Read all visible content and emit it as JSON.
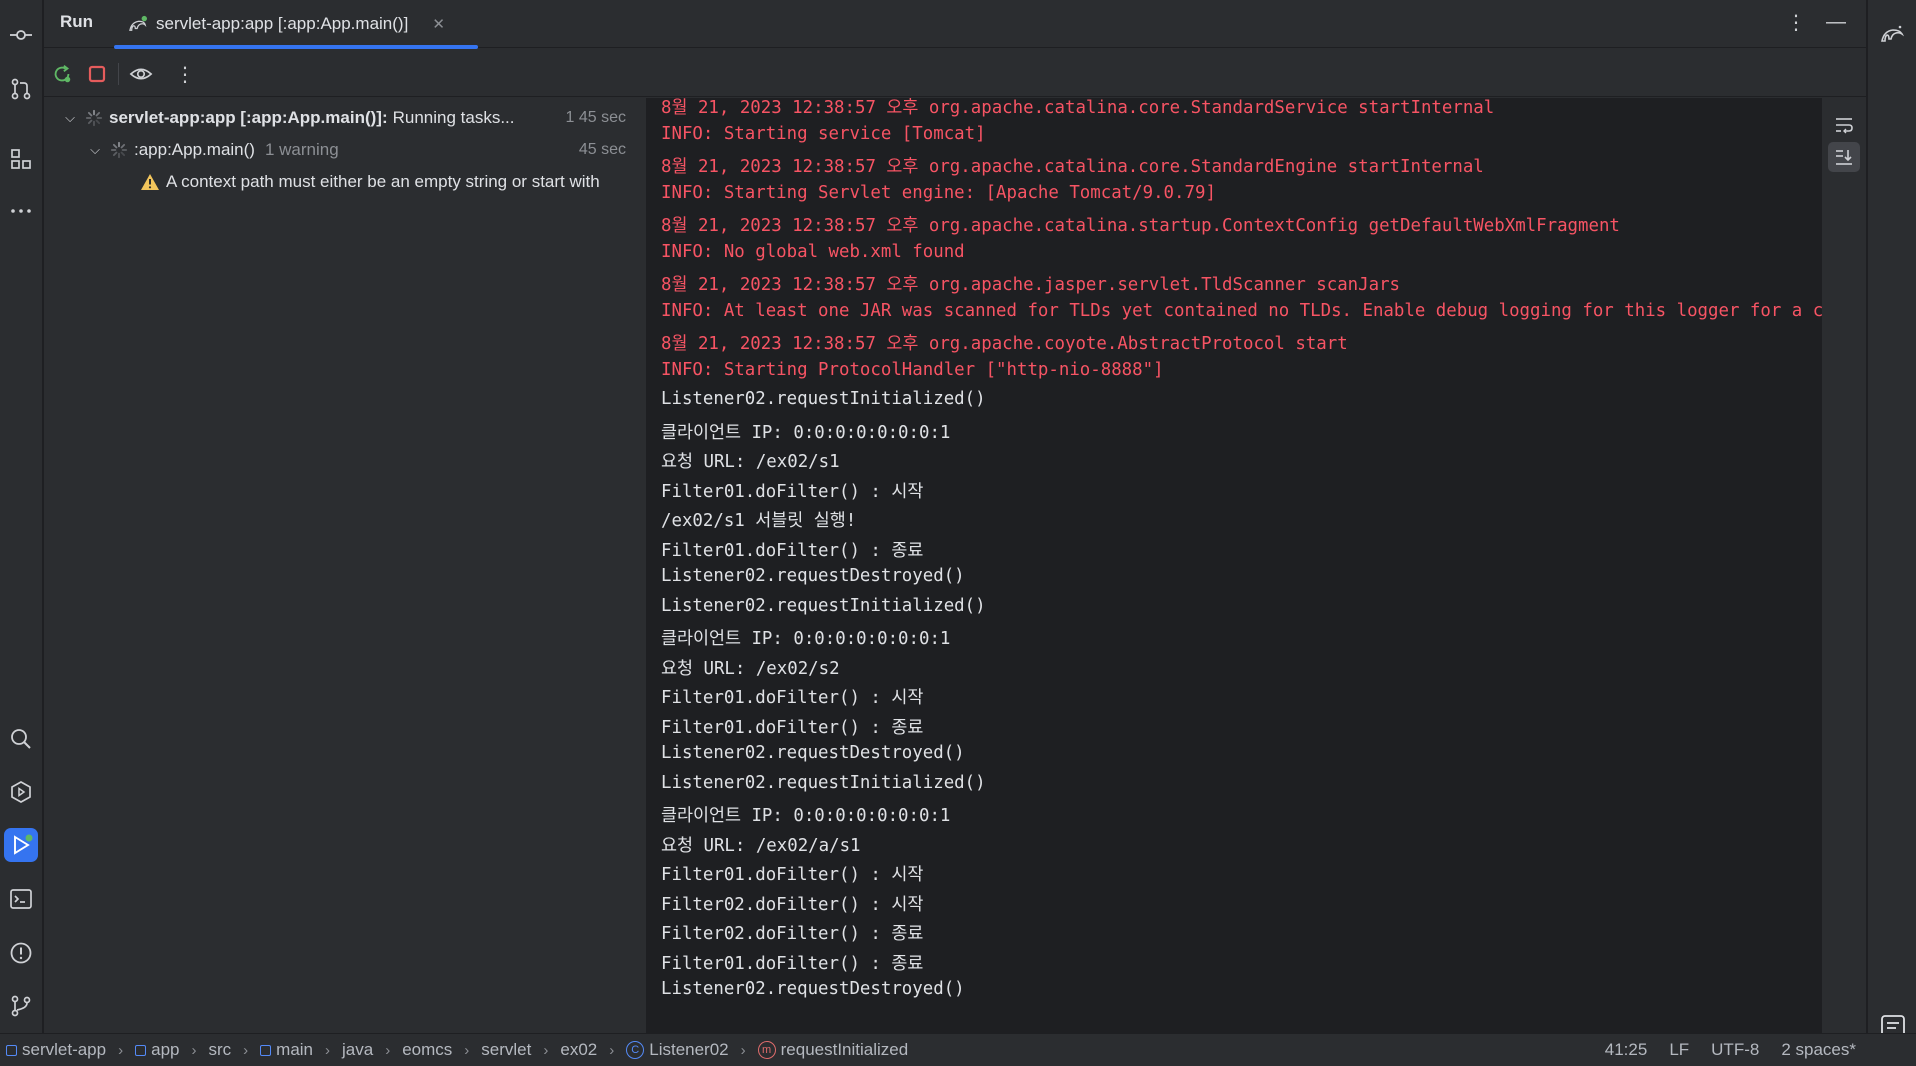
{
  "run_panel": {
    "title": "Run",
    "tab_label": "servlet-app:app [:app:App.main()]"
  },
  "tree": {
    "root": {
      "label": "servlet-app:app [:app:App.main()]:",
      "status": "Running tasks...",
      "time": "1 45 sec"
    },
    "child": {
      "label": ":app:App.main()",
      "warning_count": "1 warning",
      "time": "45 sec"
    },
    "warning": {
      "text": "A context path must either be an empty string or start with"
    }
  },
  "console": {
    "lines": [
      {
        "text": "8월 21, 2023 12:38:57 오후 org.apache.catalina.core.StandardService startInternal",
        "kind": "err"
      },
      {
        "text": "INFO: Starting service [Tomcat]",
        "kind": "err"
      },
      {
        "text": "8월 21, 2023 12:38:57 오후 org.apache.catalina.core.StandardEngine startInternal",
        "kind": "err"
      },
      {
        "text": "INFO: Starting Servlet engine: [Apache Tomcat/9.0.79]",
        "kind": "err"
      },
      {
        "text": "8월 21, 2023 12:38:57 오후 org.apache.catalina.startup.ContextConfig getDefaultWebXmlFragment",
        "kind": "err"
      },
      {
        "text": "INFO: No global web.xml found",
        "kind": "err"
      },
      {
        "text": "8월 21, 2023 12:38:57 오후 org.apache.jasper.servlet.TldScanner scanJars",
        "kind": "err"
      },
      {
        "text": "INFO: At least one JAR was scanned for TLDs yet contained no TLDs. Enable debug logging for this logger for a comple",
        "kind": "err"
      },
      {
        "text": "8월 21, 2023 12:38:57 오후 org.apache.coyote.AbstractProtocol start",
        "kind": "err"
      },
      {
        "text": "INFO: Starting ProtocolHandler [\"http-nio-8888\"]",
        "kind": "err"
      },
      {
        "text": "Listener02.requestInitialized()",
        "kind": "out"
      },
      {
        "text": "클라이언트 IP: 0:0:0:0:0:0:0:1",
        "kind": "out"
      },
      {
        "text": "요청 URL: /ex02/s1",
        "kind": "out"
      },
      {
        "text": "Filter01.doFilter() : 시작",
        "kind": "out"
      },
      {
        "text": "/ex02/s1 서블릿 실행!",
        "kind": "out"
      },
      {
        "text": "Filter01.doFilter() : 종료",
        "kind": "out"
      },
      {
        "text": "Listener02.requestDestroyed()",
        "kind": "out"
      },
      {
        "text": "Listener02.requestInitialized()",
        "kind": "out"
      },
      {
        "text": "클라이언트 IP: 0:0:0:0:0:0:0:1",
        "kind": "out"
      },
      {
        "text": "요청 URL: /ex02/s2",
        "kind": "out"
      },
      {
        "text": "Filter01.doFilter() : 시작",
        "kind": "out"
      },
      {
        "text": "Filter01.doFilter() : 종료",
        "kind": "out"
      },
      {
        "text": "Listener02.requestDestroyed()",
        "kind": "out"
      },
      {
        "text": "Listener02.requestInitialized()",
        "kind": "out"
      },
      {
        "text": "클라이언트 IP: 0:0:0:0:0:0:0:1",
        "kind": "out"
      },
      {
        "text": "요청 URL: /ex02/a/s1",
        "kind": "out"
      },
      {
        "text": "Filter01.doFilter() : 시작",
        "kind": "out"
      },
      {
        "text": "Filter02.doFilter() : 시작",
        "kind": "out"
      },
      {
        "text": "Filter02.doFilter() : 종료",
        "kind": "out"
      },
      {
        "text": "Filter01.doFilter() : 종료",
        "kind": "out"
      },
      {
        "text": "Listener02.requestDestroyed()",
        "kind": "out"
      }
    ]
  },
  "statusbar": {
    "breadcrumbs": [
      {
        "label": "servlet-app",
        "icon": "module-icon"
      },
      {
        "label": "app",
        "icon": "module-icon"
      },
      {
        "label": "src",
        "icon": "none"
      },
      {
        "label": "main",
        "icon": "module-icon"
      },
      {
        "label": "java",
        "icon": "none"
      },
      {
        "label": "eomcs",
        "icon": "none"
      },
      {
        "label": "servlet",
        "icon": "none"
      },
      {
        "label": "ex02",
        "icon": "none"
      },
      {
        "label": "Listener02",
        "icon": "class-icon"
      },
      {
        "label": "requestInitialized",
        "icon": "method-icon"
      }
    ],
    "position": "41:25",
    "line_ending": "LF",
    "encoding": "UTF-8",
    "indent": "2 spaces*"
  },
  "colors": {
    "accent": "#3574f0",
    "stderr": "#f75464",
    "warning": "#f2c55c"
  }
}
